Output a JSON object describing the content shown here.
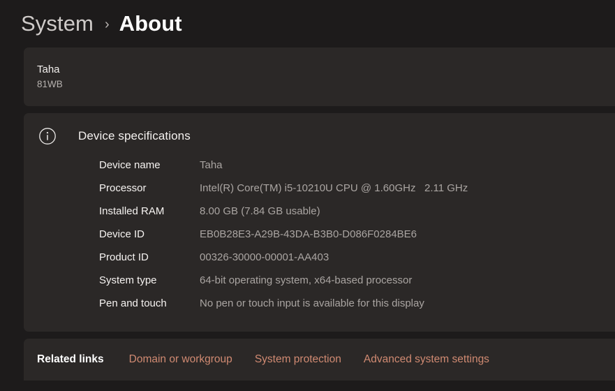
{
  "breadcrumb": {
    "parent": "System",
    "separator": "›",
    "current": "About"
  },
  "device_card": {
    "name": "Taha",
    "model": "81WB"
  },
  "device_specifications": {
    "icon": "info-circle-icon",
    "title": "Device specifications",
    "rows": [
      {
        "label": "Device name",
        "value": "Taha"
      },
      {
        "label": "Processor",
        "value": "Intel(R) Core(TM) i5-10210U CPU @ 1.60GHz   2.11 GHz"
      },
      {
        "label": "Installed RAM",
        "value": "8.00 GB (7.84 GB usable)"
      },
      {
        "label": "Device ID",
        "value": "EB0B28E3-A29B-43DA-B3B0-D086F0284BE6"
      },
      {
        "label": "Product ID",
        "value": "00326-30000-00001-AA403"
      },
      {
        "label": "System type",
        "value": "64-bit operating system, x64-based processor"
      },
      {
        "label": "Pen and touch",
        "value": "No pen or touch input is available for this display"
      }
    ]
  },
  "related_links": {
    "title": "Related links",
    "links": [
      "Domain or workgroup",
      "System protection",
      "Advanced system settings"
    ]
  },
  "colors": {
    "page_background": "#1d1b1b",
    "card_background": "#2b2827",
    "link_accent": "#d08a72",
    "primary_text": "#f6f3f1",
    "secondary_text": "#aaa5a2"
  }
}
